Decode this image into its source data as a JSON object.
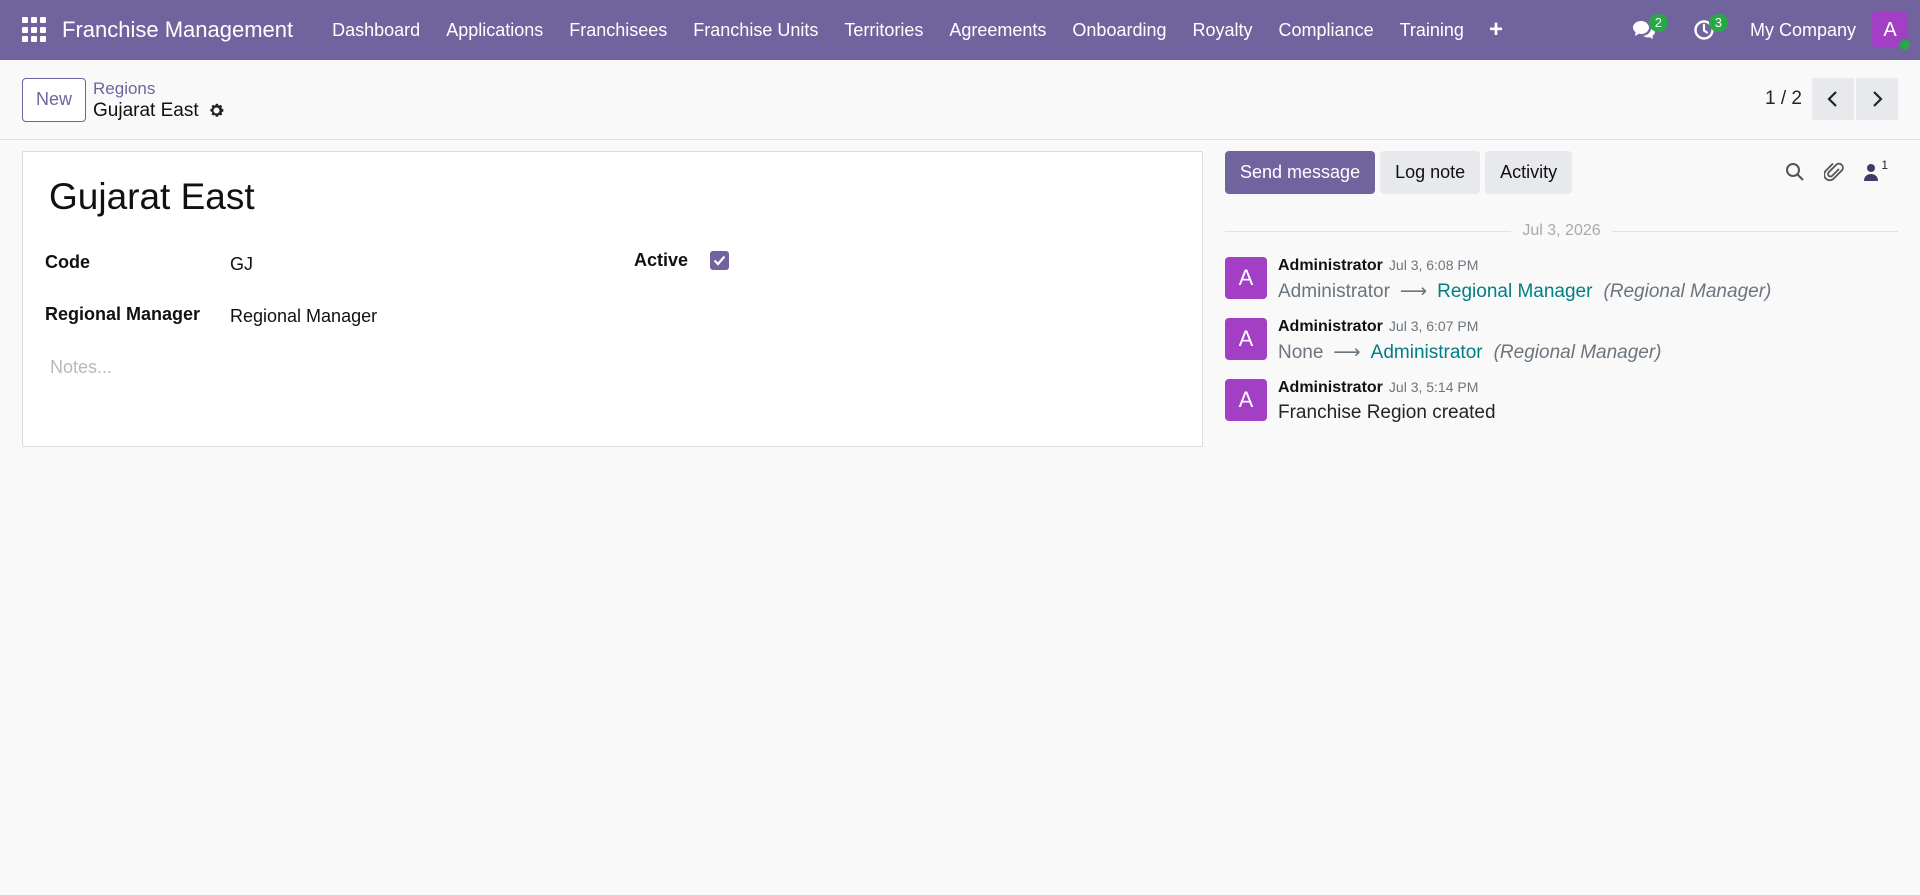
{
  "navbar": {
    "brand": "Franchise Management",
    "menu": [
      "Dashboard",
      "Applications",
      "Franchisees",
      "Franchise Units",
      "Territories",
      "Agreements",
      "Onboarding",
      "Royalty",
      "Compliance",
      "Training"
    ],
    "plus_label": "+",
    "messages_badge": "2",
    "activities_badge": "3",
    "company": "My Company",
    "user_initial": "A"
  },
  "control": {
    "new_label": "New",
    "breadcrumb_parent": "Regions",
    "breadcrumb_current": "Gujarat East",
    "pager": "1 / 2"
  },
  "form": {
    "title": "Gujarat East",
    "code_label": "Code",
    "code_value": "GJ",
    "active_label": "Active",
    "active_checked": true,
    "manager_label": "Regional Manager",
    "manager_value": "Regional Manager",
    "notes_placeholder": "Notes..."
  },
  "chatter": {
    "send_message": "Send message",
    "log_note": "Log note",
    "activity": "Activity",
    "followers_count": "1",
    "date_separator": "Jul 3, 2026",
    "messages": [
      {
        "initial": "A",
        "author": "Administrator",
        "time": "Jul 3, 6:08 PM",
        "old": "Administrator",
        "new": "Regional Manager",
        "field": "(Regional Manager)"
      },
      {
        "initial": "A",
        "author": "Administrator",
        "time": "Jul 3, 6:07 PM",
        "old": "None",
        "new": "Administrator",
        "field": "(Regional Manager)"
      },
      {
        "initial": "A",
        "author": "Administrator",
        "time": "Jul 3, 5:14 PM",
        "text": "Franchise Region created"
      }
    ],
    "arrow": "⟶"
  },
  "colors": {
    "brand": "#71639e",
    "avatar": "#a23fc4",
    "badge": "#28a745",
    "link": "#017e84"
  }
}
